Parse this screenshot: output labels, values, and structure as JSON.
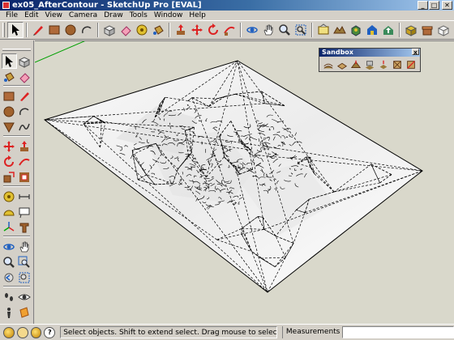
{
  "window": {
    "title": "ex05_AfterContour - SketchUp Pro [EVAL]",
    "min": "_",
    "max": "□",
    "close": "✕"
  },
  "menu": [
    "File",
    "Edit",
    "View",
    "Camera",
    "Draw",
    "Tools",
    "Window",
    "Help"
  ],
  "sandbox": {
    "title": "Sandbox",
    "close": "x"
  },
  "status": {
    "message": "Select objects. Shift to extend select. Drag mouse to select multiple.",
    "measurements_label": "Measurements",
    "measurements_value": "",
    "help_glyph": "?"
  },
  "colors": {
    "viewport_bg": "#d9d8cb",
    "terrain_face": "#ffffff",
    "terrain_edge": "#000000",
    "axis_green": "#00a000",
    "title_gradient_start": "#0a246a"
  }
}
